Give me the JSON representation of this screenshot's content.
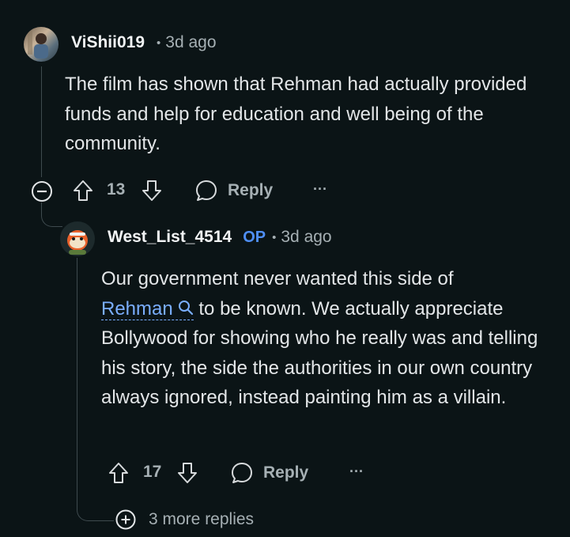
{
  "comment1": {
    "username": "ViShii019",
    "time": "3d ago",
    "body": "The film has shown that Rehman had actually provided funds and help for education and well being of the community.",
    "votes": "13",
    "reply_label": "Reply",
    "more_label": "···"
  },
  "comment2": {
    "username": "West_List_4514",
    "op_badge": "OP",
    "time": "3d ago",
    "body_before": "Our government never wanted this side of",
    "link_text": "Rehman",
    "body_after": "to be known. We actually appreciate Bollywood for showing who he really was and telling his story, the side the authorities in our own country always ignored, instead painting him as a villain.",
    "votes": "17",
    "reply_label": "Reply",
    "more_label": "···"
  },
  "more_replies": "3 more replies",
  "colors": {
    "background": "#0b1416",
    "text": "#e3e6e8",
    "meta": "#a6b0b4",
    "op": "#4f8ff7",
    "link": "#7aaeff"
  },
  "icons": [
    "collapse-icon",
    "upvote-icon",
    "downvote-icon",
    "comment-icon",
    "more-icon",
    "expand-icon",
    "search-icon"
  ]
}
